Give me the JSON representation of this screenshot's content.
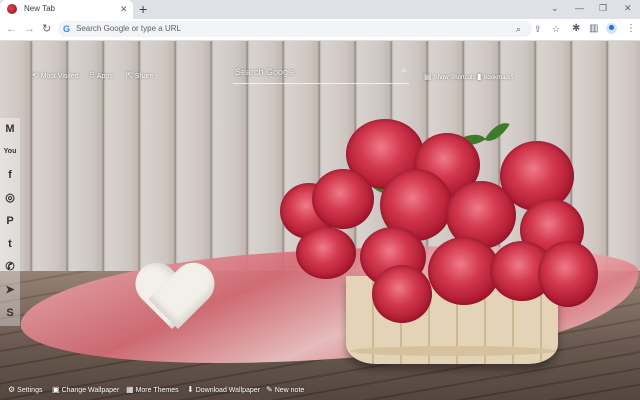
{
  "tab": {
    "title": "New Tab",
    "close": "✕",
    "new_tab": "+"
  },
  "window": {
    "minimize": "—",
    "maximize": "❐",
    "close": "✕",
    "dropdown": "⌄"
  },
  "nav": {
    "back": "←",
    "forward": "→",
    "reload": "↻"
  },
  "omnibox": {
    "placeholder": "Search Google or type a URL",
    "g_logo": "G"
  },
  "omnibox_icons": {
    "zoom": "⌕",
    "share": "⇪",
    "bookmark": "☆"
  },
  "toolbar_icons": {
    "extensions": "✱",
    "sidepanel": "▥",
    "menu": "⋮"
  },
  "top_links": {
    "most_visited": "Most Visited",
    "apps": "Apps",
    "share": "Share",
    "show_shortcuts": "Show Shortcuts",
    "bookmarks": "Bookmarks"
  },
  "search": {
    "placeholder": "Search Google",
    "glass": "⌕"
  },
  "social": [
    {
      "name": "gmail",
      "glyph": "M"
    },
    {
      "name": "youtube",
      "glyph": "You"
    },
    {
      "name": "facebook",
      "glyph": "f"
    },
    {
      "name": "instagram",
      "glyph": "◎"
    },
    {
      "name": "pinterest",
      "glyph": "P"
    },
    {
      "name": "twitter",
      "glyph": "t"
    },
    {
      "name": "whatsapp",
      "glyph": "✆"
    },
    {
      "name": "telegram",
      "glyph": "➤"
    },
    {
      "name": "skype",
      "glyph": "S"
    }
  ],
  "bottom": {
    "settings": "Settings",
    "change_wallpaper": "Change Wallpaper",
    "more_themes": "More Themes",
    "download_wallpaper": "Download Wallpaper",
    "new_note": "New note"
  },
  "icons": {
    "settings": "⚙",
    "wallpaper": "▣",
    "themes": "▦",
    "download": "⬇",
    "note": "✎",
    "most_visited": "⟲",
    "apps": "⠿",
    "share": "⇱",
    "shortcuts": "▤",
    "bookmarks": "▮"
  }
}
